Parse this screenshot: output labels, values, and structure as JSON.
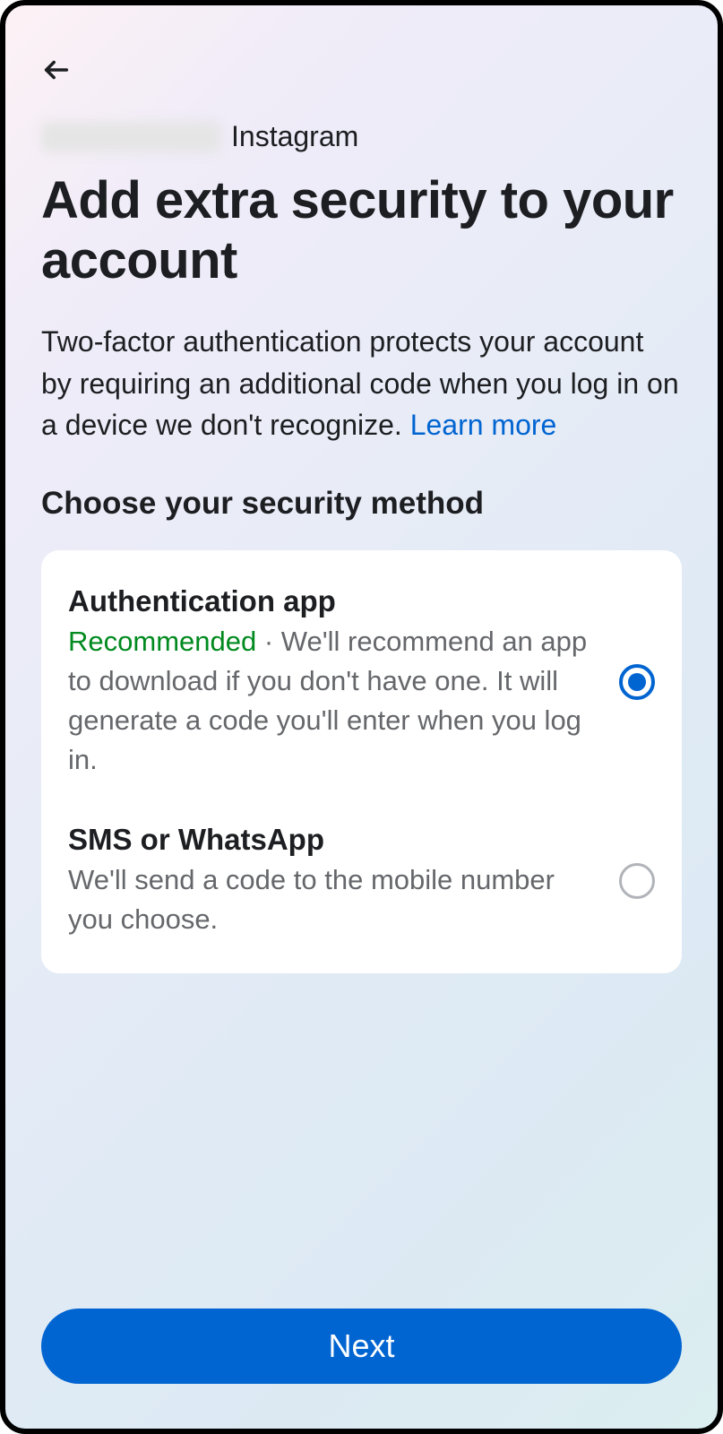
{
  "header": {
    "platform": "Instagram",
    "title": "Add extra security to your account",
    "description": "Two-factor authentication protects your account by requiring an additional code when you log in on a device we don't recognize. ",
    "learn_more": "Learn more"
  },
  "section": {
    "title": "Choose your security method"
  },
  "options": [
    {
      "title": "Authentication app",
      "recommended_label": "Recommended",
      "separator": " · ",
      "description": "We'll recommend an app to download if you don't have one. It will generate a code you'll enter when you log in.",
      "selected": true
    },
    {
      "title": "SMS or WhatsApp",
      "description": "We'll send a code to the mobile number you choose.",
      "selected": false
    }
  ],
  "footer": {
    "next_label": "Next"
  }
}
